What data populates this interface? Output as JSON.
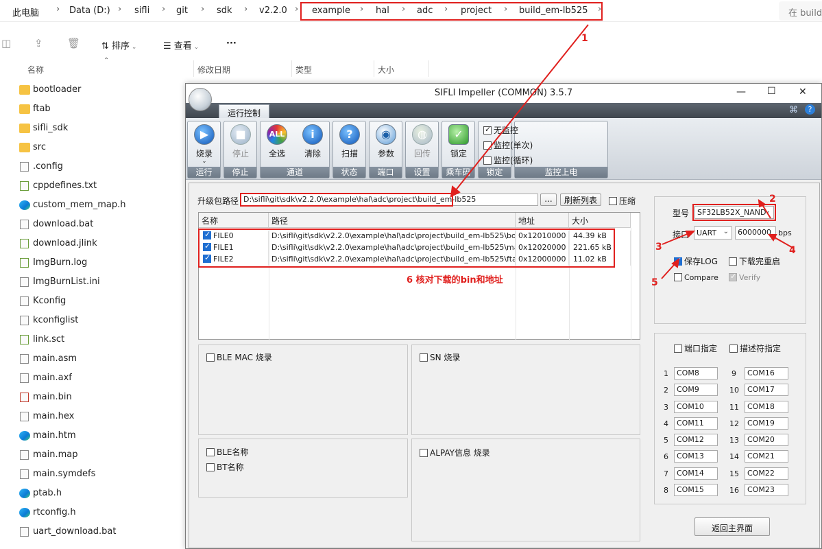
{
  "explorer": {
    "breadcrumb": [
      "此电脑",
      "Data (D:)",
      "sifli",
      "git",
      "sdk",
      "v2.2.0",
      "example",
      "hal",
      "adc",
      "project",
      "build_em-lb525"
    ],
    "search_placeholder": "在 build",
    "toolbar": {
      "sort": "排序",
      "view": "查看",
      "more": "···"
    },
    "columns": {
      "name": "名称",
      "modified": "修改日期",
      "type": "类型",
      "size": "大小"
    },
    "files": [
      "bootloader",
      "ftab",
      "sifli_sdk",
      "src",
      ".config",
      "cppdefines.txt",
      "custom_mem_map.h",
      "download.bat",
      "download.jlink",
      "ImgBurn.log",
      "ImgBurnList.ini",
      "Kconfig",
      "kconfiglist",
      "link.sct",
      "main.asm",
      "main.axf",
      "main.bin",
      "main.hex",
      "main.htm",
      "main.map",
      "main.symdefs",
      "ptab.h",
      "rtconfig.h",
      "uart_download.bat"
    ]
  },
  "app": {
    "title": "SIFLI Impeller (COMMON) 3.5.7",
    "tab": "运行控制",
    "ribbon": {
      "buttons": [
        "烧录",
        "停止",
        "全选",
        "清除",
        "扫描",
        "参数",
        "回传",
        "锁定"
      ],
      "groups": [
        "运行",
        "停止",
        "通道",
        "状态",
        "端口",
        "设置",
        "乘车码",
        "锁定",
        "监控上电"
      ],
      "monitor": [
        "无监控",
        "监控(单次)",
        "监控(循环)"
      ]
    },
    "path_label": "升级包路径",
    "path_value": "D:\\sifli\\git\\sdk\\v2.2.0\\example\\hal\\adc\\project\\build_em-lb525",
    "browse": "...",
    "refresh": "刷新列表",
    "compress": "压缩",
    "grid": {
      "headers": [
        "名称",
        "路径",
        "地址",
        "大小"
      ],
      "rows": [
        {
          "name": "FILE0",
          "path": "D:\\sifli\\git\\sdk\\v2.2.0\\example\\hal\\adc\\project\\build_em-lb525\\bootlo...",
          "addr": "0x12010000",
          "size": "44.39 kB"
        },
        {
          "name": "FILE1",
          "path": "D:\\sifli\\git\\sdk\\v2.2.0\\example\\hal\\adc\\project\\build_em-lb525\\main.bin",
          "addr": "0x12020000",
          "size": "221.65 kB"
        },
        {
          "name": "FILE2",
          "path": "D:\\sifli\\git\\sdk\\v2.2.0\\example\\hal\\adc\\project\\build_em-lb525\\ftab\\ft...",
          "addr": "0x12000000",
          "size": "11.02 kB"
        }
      ]
    },
    "panels": {
      "ble_mac": "BLE MAC 烧录",
      "sn": "SN 烧录",
      "ble_name": "BLE名称",
      "bt_name": "BT名称",
      "alpay": "ALPAY信息 烧录"
    },
    "right": {
      "model_label": "型号",
      "model_value": "SF32LB52X_NAND",
      "port_label": "接口",
      "port_value": "UART",
      "baud_value": "6000000",
      "baud_unit": "bps",
      "save_log": "保存LOG",
      "reboot": "下载完重启",
      "compare": "Compare",
      "verify": "Verify",
      "port_assign": "端口指定",
      "desc_assign": "描述符指定",
      "com_left": [
        {
          "n": "1",
          "v": "COM8"
        },
        {
          "n": "2",
          "v": "COM9"
        },
        {
          "n": "3",
          "v": "COM10"
        },
        {
          "n": "4",
          "v": "COM11"
        },
        {
          "n": "5",
          "v": "COM12"
        },
        {
          "n": "6",
          "v": "COM13"
        },
        {
          "n": "7",
          "v": "COM14"
        },
        {
          "n": "8",
          "v": "COM15"
        }
      ],
      "com_right": [
        {
          "n": "9",
          "v": "COM16"
        },
        {
          "n": "10",
          "v": "COM17"
        },
        {
          "n": "11",
          "v": "COM18"
        },
        {
          "n": "12",
          "v": "COM19"
        },
        {
          "n": "13",
          "v": "COM20"
        },
        {
          "n": "14",
          "v": "COM21"
        },
        {
          "n": "15",
          "v": "COM22"
        },
        {
          "n": "16",
          "v": "COM23"
        }
      ],
      "back": "返回主界面"
    }
  },
  "annotations": {
    "n1": "1",
    "n2": "2",
    "n3": "3",
    "n4": "4",
    "n5": "5",
    "note6": "6 核对下载的bin和地址"
  },
  "colors": {
    "annotation": "#e0201e",
    "checkbox": "#1f6fd1"
  }
}
